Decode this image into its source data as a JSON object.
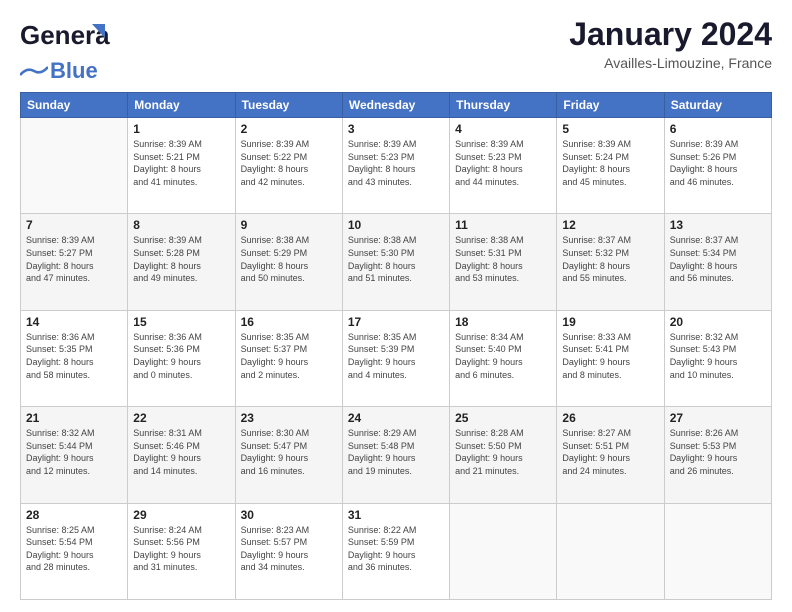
{
  "header": {
    "logo_general": "General",
    "logo_blue": "Blue",
    "month": "January 2024",
    "location": "Availles-Limouzine, France"
  },
  "days_of_week": [
    "Sunday",
    "Monday",
    "Tuesday",
    "Wednesday",
    "Thursday",
    "Friday",
    "Saturday"
  ],
  "weeks": [
    [
      {
        "day": "",
        "sunrise": "",
        "sunset": "",
        "daylight": ""
      },
      {
        "day": "1",
        "sunrise": "Sunrise: 8:39 AM",
        "sunset": "Sunset: 5:21 PM",
        "daylight": "Daylight: 8 hours and 41 minutes."
      },
      {
        "day": "2",
        "sunrise": "Sunrise: 8:39 AM",
        "sunset": "Sunset: 5:22 PM",
        "daylight": "Daylight: 8 hours and 42 minutes."
      },
      {
        "day": "3",
        "sunrise": "Sunrise: 8:39 AM",
        "sunset": "Sunset: 5:23 PM",
        "daylight": "Daylight: 8 hours and 43 minutes."
      },
      {
        "day": "4",
        "sunrise": "Sunrise: 8:39 AM",
        "sunset": "Sunset: 5:23 PM",
        "daylight": "Daylight: 8 hours and 44 minutes."
      },
      {
        "day": "5",
        "sunrise": "Sunrise: 8:39 AM",
        "sunset": "Sunset: 5:24 PM",
        "daylight": "Daylight: 8 hours and 45 minutes."
      },
      {
        "day": "6",
        "sunrise": "Sunrise: 8:39 AM",
        "sunset": "Sunset: 5:26 PM",
        "daylight": "Daylight: 8 hours and 46 minutes."
      }
    ],
    [
      {
        "day": "7",
        "sunrise": "Sunrise: 8:39 AM",
        "sunset": "Sunset: 5:27 PM",
        "daylight": "Daylight: 8 hours and 47 minutes."
      },
      {
        "day": "8",
        "sunrise": "Sunrise: 8:39 AM",
        "sunset": "Sunset: 5:28 PM",
        "daylight": "Daylight: 8 hours and 49 minutes."
      },
      {
        "day": "9",
        "sunrise": "Sunrise: 8:38 AM",
        "sunset": "Sunset: 5:29 PM",
        "daylight": "Daylight: 8 hours and 50 minutes."
      },
      {
        "day": "10",
        "sunrise": "Sunrise: 8:38 AM",
        "sunset": "Sunset: 5:30 PM",
        "daylight": "Daylight: 8 hours and 51 minutes."
      },
      {
        "day": "11",
        "sunrise": "Sunrise: 8:38 AM",
        "sunset": "Sunset: 5:31 PM",
        "daylight": "Daylight: 8 hours and 53 minutes."
      },
      {
        "day": "12",
        "sunrise": "Sunrise: 8:37 AM",
        "sunset": "Sunset: 5:32 PM",
        "daylight": "Daylight: 8 hours and 55 minutes."
      },
      {
        "day": "13",
        "sunrise": "Sunrise: 8:37 AM",
        "sunset": "Sunset: 5:34 PM",
        "daylight": "Daylight: 8 hours and 56 minutes."
      }
    ],
    [
      {
        "day": "14",
        "sunrise": "Sunrise: 8:36 AM",
        "sunset": "Sunset: 5:35 PM",
        "daylight": "Daylight: 8 hours and 58 minutes."
      },
      {
        "day": "15",
        "sunrise": "Sunrise: 8:36 AM",
        "sunset": "Sunset: 5:36 PM",
        "daylight": "Daylight: 9 hours and 0 minutes."
      },
      {
        "day": "16",
        "sunrise": "Sunrise: 8:35 AM",
        "sunset": "Sunset: 5:37 PM",
        "daylight": "Daylight: 9 hours and 2 minutes."
      },
      {
        "day": "17",
        "sunrise": "Sunrise: 8:35 AM",
        "sunset": "Sunset: 5:39 PM",
        "daylight": "Daylight: 9 hours and 4 minutes."
      },
      {
        "day": "18",
        "sunrise": "Sunrise: 8:34 AM",
        "sunset": "Sunset: 5:40 PM",
        "daylight": "Daylight: 9 hours and 6 minutes."
      },
      {
        "day": "19",
        "sunrise": "Sunrise: 8:33 AM",
        "sunset": "Sunset: 5:41 PM",
        "daylight": "Daylight: 9 hours and 8 minutes."
      },
      {
        "day": "20",
        "sunrise": "Sunrise: 8:32 AM",
        "sunset": "Sunset: 5:43 PM",
        "daylight": "Daylight: 9 hours and 10 minutes."
      }
    ],
    [
      {
        "day": "21",
        "sunrise": "Sunrise: 8:32 AM",
        "sunset": "Sunset: 5:44 PM",
        "daylight": "Daylight: 9 hours and 12 minutes."
      },
      {
        "day": "22",
        "sunrise": "Sunrise: 8:31 AM",
        "sunset": "Sunset: 5:46 PM",
        "daylight": "Daylight: 9 hours and 14 minutes."
      },
      {
        "day": "23",
        "sunrise": "Sunrise: 8:30 AM",
        "sunset": "Sunset: 5:47 PM",
        "daylight": "Daylight: 9 hours and 16 minutes."
      },
      {
        "day": "24",
        "sunrise": "Sunrise: 8:29 AM",
        "sunset": "Sunset: 5:48 PM",
        "daylight": "Daylight: 9 hours and 19 minutes."
      },
      {
        "day": "25",
        "sunrise": "Sunrise: 8:28 AM",
        "sunset": "Sunset: 5:50 PM",
        "daylight": "Daylight: 9 hours and 21 minutes."
      },
      {
        "day": "26",
        "sunrise": "Sunrise: 8:27 AM",
        "sunset": "Sunset: 5:51 PM",
        "daylight": "Daylight: 9 hours and 24 minutes."
      },
      {
        "day": "27",
        "sunrise": "Sunrise: 8:26 AM",
        "sunset": "Sunset: 5:53 PM",
        "daylight": "Daylight: 9 hours and 26 minutes."
      }
    ],
    [
      {
        "day": "28",
        "sunrise": "Sunrise: 8:25 AM",
        "sunset": "Sunset: 5:54 PM",
        "daylight": "Daylight: 9 hours and 28 minutes."
      },
      {
        "day": "29",
        "sunrise": "Sunrise: 8:24 AM",
        "sunset": "Sunset: 5:56 PM",
        "daylight": "Daylight: 9 hours and 31 minutes."
      },
      {
        "day": "30",
        "sunrise": "Sunrise: 8:23 AM",
        "sunset": "Sunset: 5:57 PM",
        "daylight": "Daylight: 9 hours and 34 minutes."
      },
      {
        "day": "31",
        "sunrise": "Sunrise: 8:22 AM",
        "sunset": "Sunset: 5:59 PM",
        "daylight": "Daylight: 9 hours and 36 minutes."
      },
      {
        "day": "",
        "sunrise": "",
        "sunset": "",
        "daylight": ""
      },
      {
        "day": "",
        "sunrise": "",
        "sunset": "",
        "daylight": ""
      },
      {
        "day": "",
        "sunrise": "",
        "sunset": "",
        "daylight": ""
      }
    ]
  ]
}
